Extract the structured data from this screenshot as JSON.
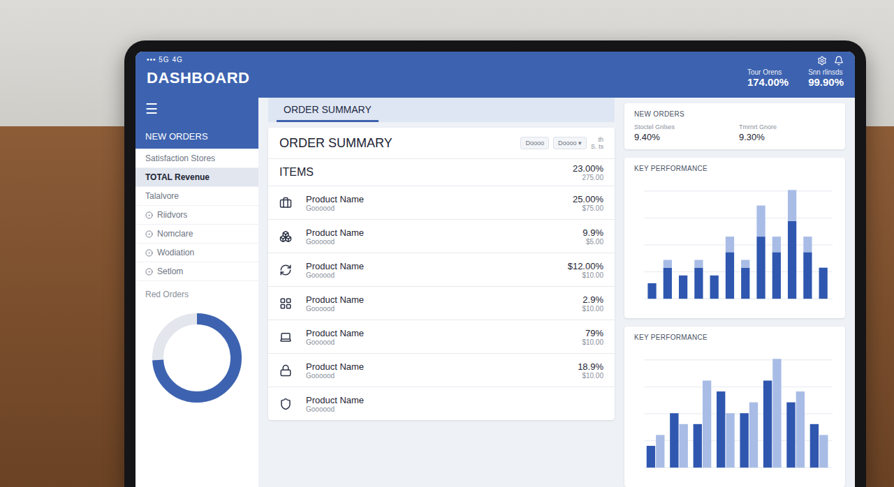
{
  "status_bar": {
    "text": "••• 5G 4G"
  },
  "header": {
    "title": "DASHBOARD",
    "stats": [
      {
        "label": "Tour Orens",
        "value": "174.00%"
      },
      {
        "label": "Snn rlinsds",
        "value": "99.90%"
      }
    ]
  },
  "sidebar": {
    "menu_icon": "☰",
    "items": [
      {
        "label": "NEW ORDERS",
        "kind": "heading",
        "selected": false
      },
      {
        "label": "Satisfaction Stores",
        "kind": "plain",
        "selected": false
      },
      {
        "label": "TOTAL Revenue",
        "kind": "plain",
        "selected": true
      },
      {
        "label": "Talalvore",
        "kind": "plain",
        "selected": false
      },
      {
        "label": "Riidvors",
        "kind": "icon",
        "selected": false
      },
      {
        "label": "Nomclare",
        "kind": "icon",
        "selected": false
      },
      {
        "label": "Wodiation",
        "kind": "icon",
        "selected": false
      },
      {
        "label": "Setlom",
        "kind": "icon",
        "selected": false
      }
    ],
    "section": "Red Orders",
    "donut": {
      "level": 0.74
    }
  },
  "order_summary": {
    "tab": "ORDER SUMMARY",
    "title": "ORDER SUMMARY",
    "meta": [
      "th",
      "S. ts"
    ],
    "buttons": [
      {
        "label": "Doooo"
      },
      {
        "label": "Doooo ▾"
      }
    ],
    "items_header": {
      "label": "ITEMS",
      "value": "23.00%",
      "sub": "275.00"
    },
    "rows": [
      {
        "name": "Product Name",
        "sub": "Goooood",
        "value": "25.00%",
        "detail": "$75.00"
      },
      {
        "name": "Product Name",
        "sub": "Goooood",
        "value": "9.9%",
        "detail": "$5.00"
      },
      {
        "name": "Product Name",
        "sub": "Goooood",
        "value": "$12.00%",
        "detail": "$10.00"
      },
      {
        "name": "Product Name",
        "sub": "Goooood",
        "value": "2.9%",
        "detail": "$10.00"
      },
      {
        "name": "Product Name",
        "sub": "Goooood",
        "value": "79%",
        "detail": "$10.00"
      },
      {
        "name": "Product Name",
        "sub": "Goooood",
        "value": "18.9%",
        "detail": "$10.00"
      },
      {
        "name": "Product Name",
        "sub": "Goooood",
        "value": "",
        "detail": ""
      }
    ]
  },
  "new_orders": {
    "title": "NEW ORDERS",
    "stats": [
      {
        "value": "9.40%",
        "label": "Stoctel Gnlses"
      },
      {
        "value": "9.30%",
        "label": "Tmrnrt Gnore"
      }
    ]
  },
  "charts": [
    {
      "title": "KEY PERFORMANCE",
      "kind": "stacked",
      "series": [
        {
          "color": "#2f57b0",
          "values": [
            1,
            2,
            1.5,
            2,
            1.5,
            3,
            2,
            4,
            3,
            5,
            3,
            2
          ]
        },
        {
          "color": "#a8bce6",
          "values": [
            0,
            0.5,
            0,
            0.5,
            0,
            1,
            0.5,
            2,
            1,
            2,
            1,
            0
          ]
        }
      ]
    },
    {
      "title": "KEY PERFORMANCE",
      "kind": "grouped",
      "series": [
        {
          "color": "#2f57b0",
          "values": [
            2,
            5,
            4,
            7,
            5,
            8,
            6,
            4
          ]
        },
        {
          "color": "#a8bce6",
          "values": [
            3,
            4,
            8,
            5,
            6,
            10,
            7,
            3
          ]
        }
      ]
    }
  ]
}
